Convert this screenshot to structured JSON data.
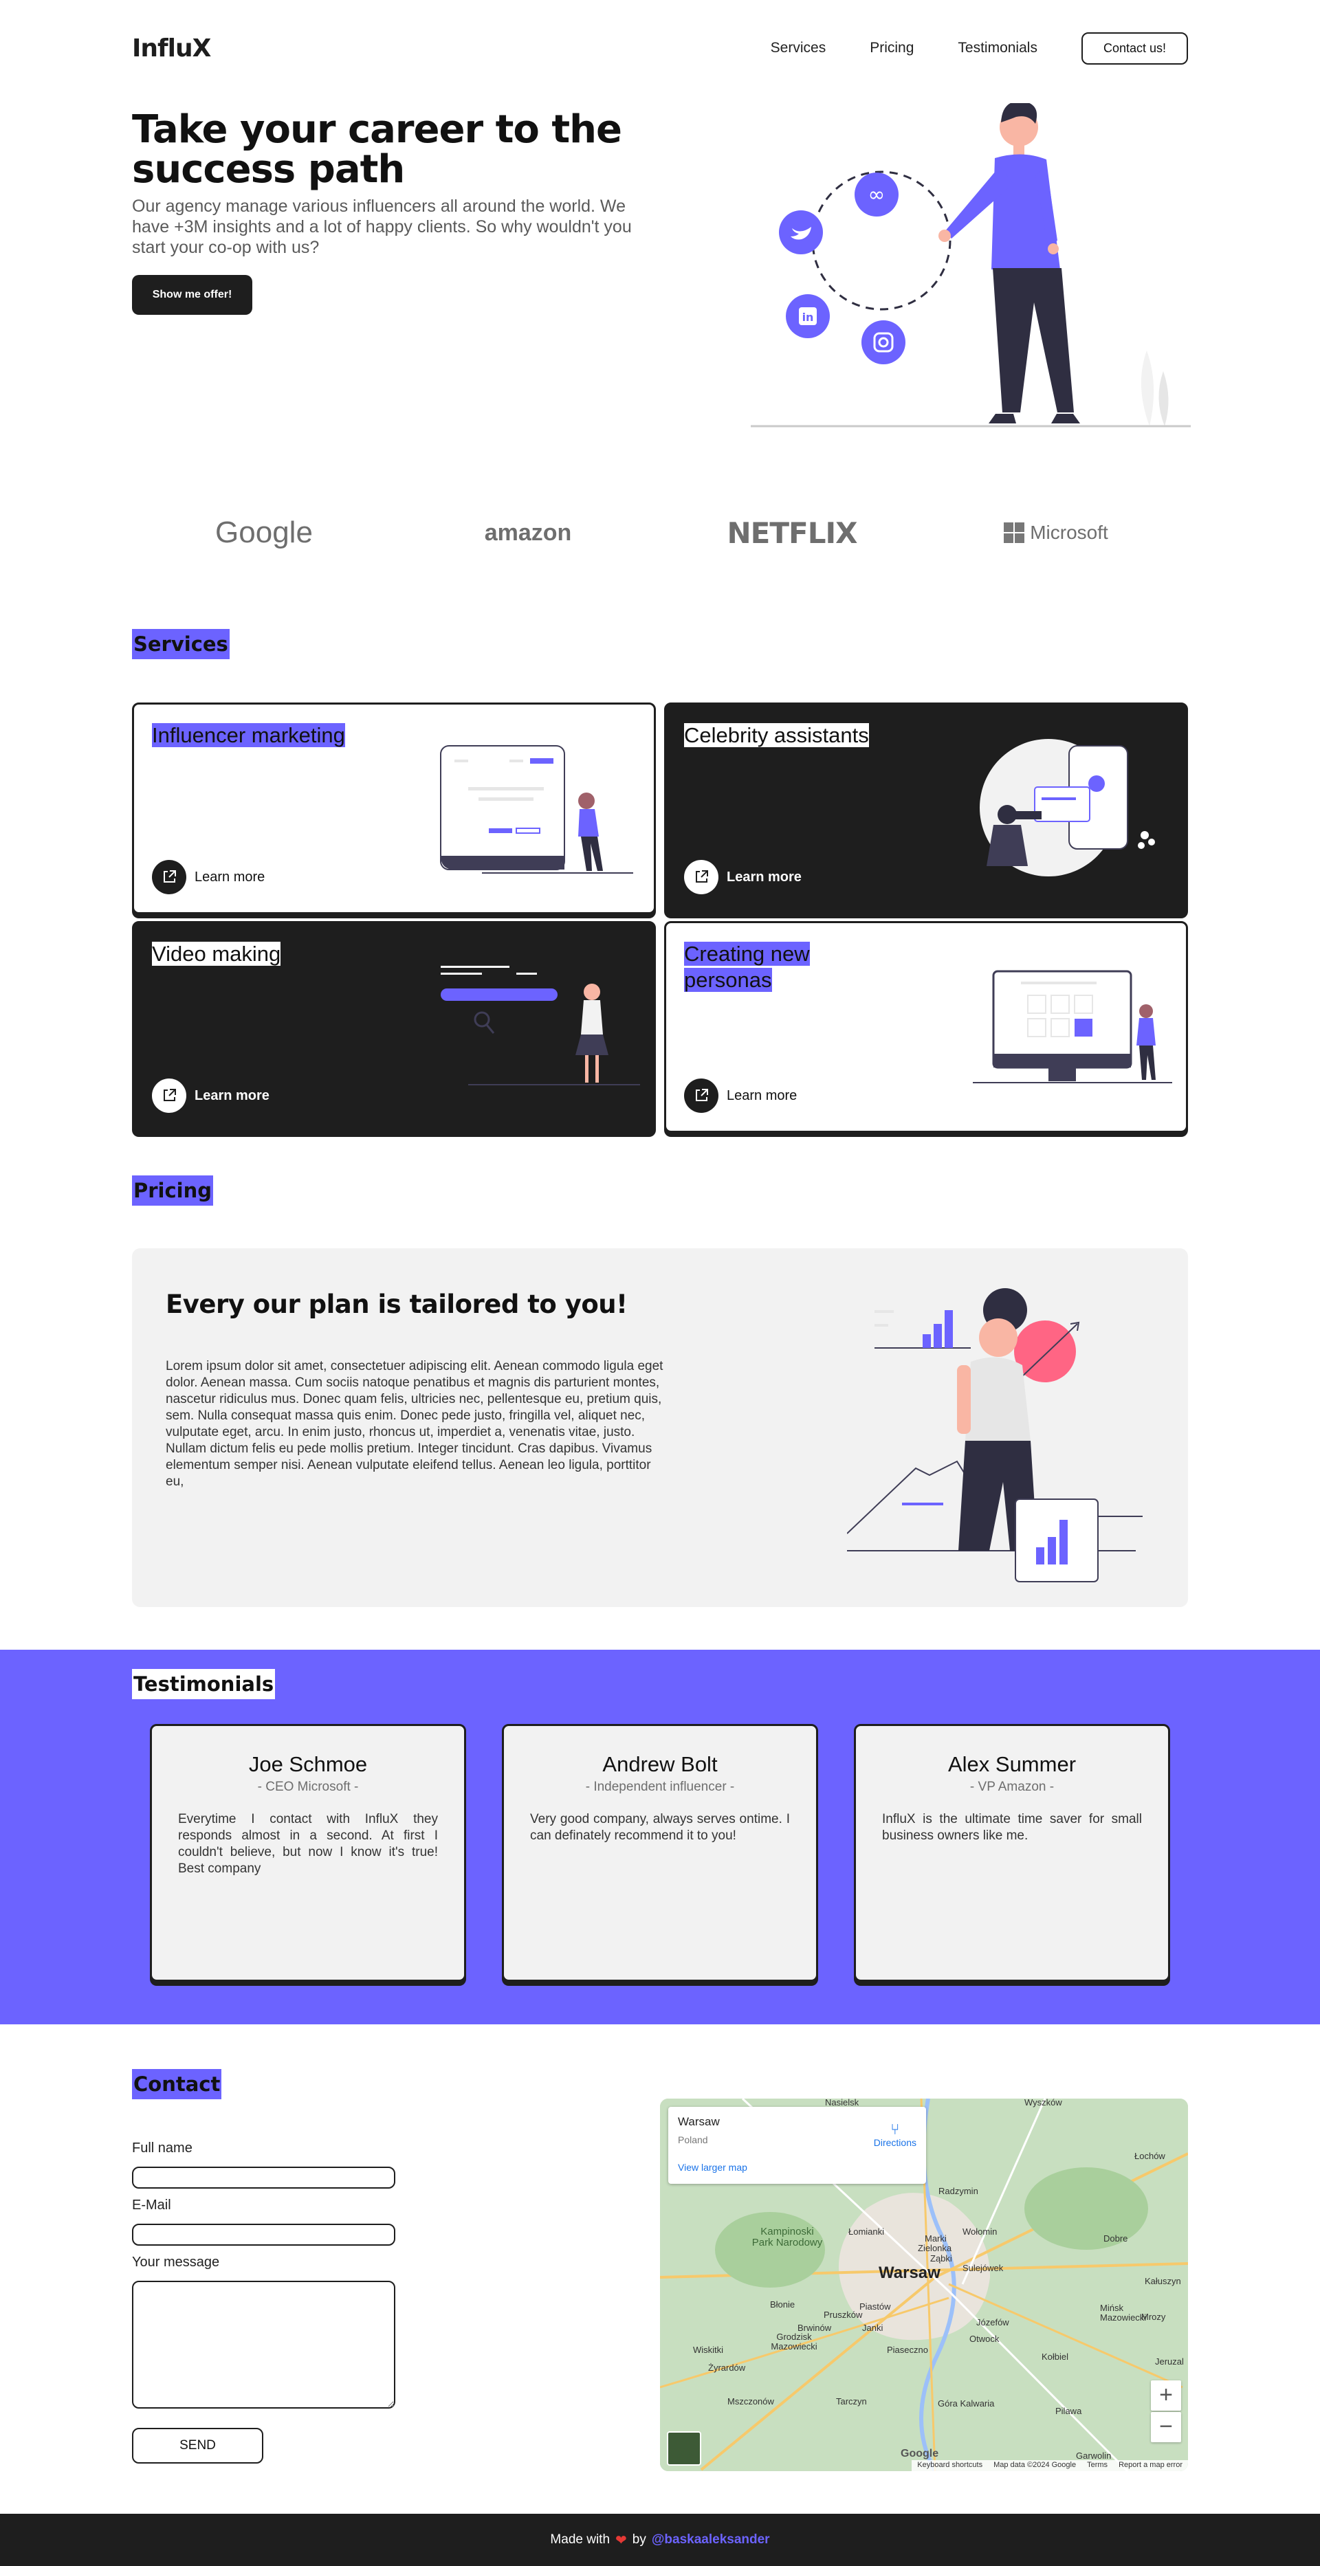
{
  "header": {
    "logo": "InfluX",
    "nav": [
      "Services",
      "Pricing",
      "Testimonials"
    ],
    "cta": "Contact us!"
  },
  "hero": {
    "title": "Take your career to the success path",
    "text": "Our agency manage various influencers all around the world. We have +3M insights and a lot of happy clients. So why wouldn't you start your co-op with us?",
    "button": "Show me offer!"
  },
  "brands": [
    "Google",
    "amazon",
    "NETFLIX",
    "Microsoft"
  ],
  "services": {
    "label": "Services",
    "cards": [
      {
        "title": "Influencer marketing",
        "link": "Learn more"
      },
      {
        "title": "Celebrity assistants",
        "link": "Learn more"
      },
      {
        "title": "Video making",
        "link": "Learn more"
      },
      {
        "title": "Creating new personas",
        "link": "Learn more"
      }
    ]
  },
  "pricing": {
    "label": "Pricing",
    "title": "Every our plan is tailored to you!",
    "text": "Lorem ipsum dolor sit amet, consectetuer adipiscing elit. Aenean commodo ligula eget dolor. Aenean massa. Cum sociis natoque penatibus et magnis dis parturient montes, nascetur ridiculus mus. Donec quam felis, ultricies nec, pellentesque eu, pretium quis, sem. Nulla consequat massa quis enim. Donec pede justo, fringilla vel, aliquet nec, vulputate eget, arcu. In enim justo, rhoncus ut, imperdiet a, venenatis vitae, justo. Nullam dictum felis eu pede mollis pretium. Integer tincidunt. Cras dapibus. Vivamus elementum semper nisi. Aenean vulputate eleifend tellus. Aenean leo ligula, porttitor eu,"
  },
  "testimonials": {
    "label": "Testimonials",
    "items": [
      {
        "name": "Joe Schmoe",
        "role": "- CEO Microsoft -",
        "text": "Everytime I contact with InfluX they responds almost in a second. At first I couldn't believe, but now I know it's true! Best company"
      },
      {
        "name": "Andrew Bolt",
        "role": "- Independent influencer -",
        "text": "Very good company, always serves ontime. I can definately recommend it to you!"
      },
      {
        "name": "Alex Summer",
        "role": "- VP Amazon -",
        "text": "InfluX is the ultimate time saver for small business owners like me."
      }
    ]
  },
  "contact": {
    "label": "Contact",
    "full_name": "Full name",
    "email": "E-Mail",
    "message": "Your message",
    "send": "SEND"
  },
  "map": {
    "place": "Warsaw",
    "country": "Poland",
    "directions": "Directions",
    "larger": "View larger map",
    "city_label": "Warsaw",
    "towns": [
      "Nasielsk",
      "Wyszków",
      "Radzymin",
      "Łochów",
      "Kampinoski Park Narodowy",
      "Łomianki",
      "Marki",
      "Wołomin",
      "Dobre",
      "Zielonka",
      "Sulejówek",
      "Ząbki",
      "Błonie",
      "Pruszków",
      "Piastów",
      "Mińsk Mazowiecki",
      "Mrozy",
      "Brwinów",
      "Grodzisk Mazowiecki",
      "Janki",
      "Józefów",
      "Otwock",
      "Wiskitki",
      "Piaseczno",
      "Żyrardów",
      "Kołbiel",
      "Mszczonów",
      "Tarczyn",
      "Góra Kalwaria",
      "Pilawa",
      "Garwolin",
      "Kałuszyn",
      "Jeruzal"
    ],
    "footer": [
      "Keyboard shortcuts",
      "Map data ©2024 Google",
      "Terms",
      "Report a map error"
    ],
    "google": "Google"
  },
  "footer": {
    "made": "Made with",
    "by": "by",
    "author": "@baskaaleksander"
  },
  "colors": {
    "accent": "#6c63ff",
    "dark": "#1e1e1e",
    "light_bg": "#f2f2f2",
    "heart": "#e53935"
  }
}
